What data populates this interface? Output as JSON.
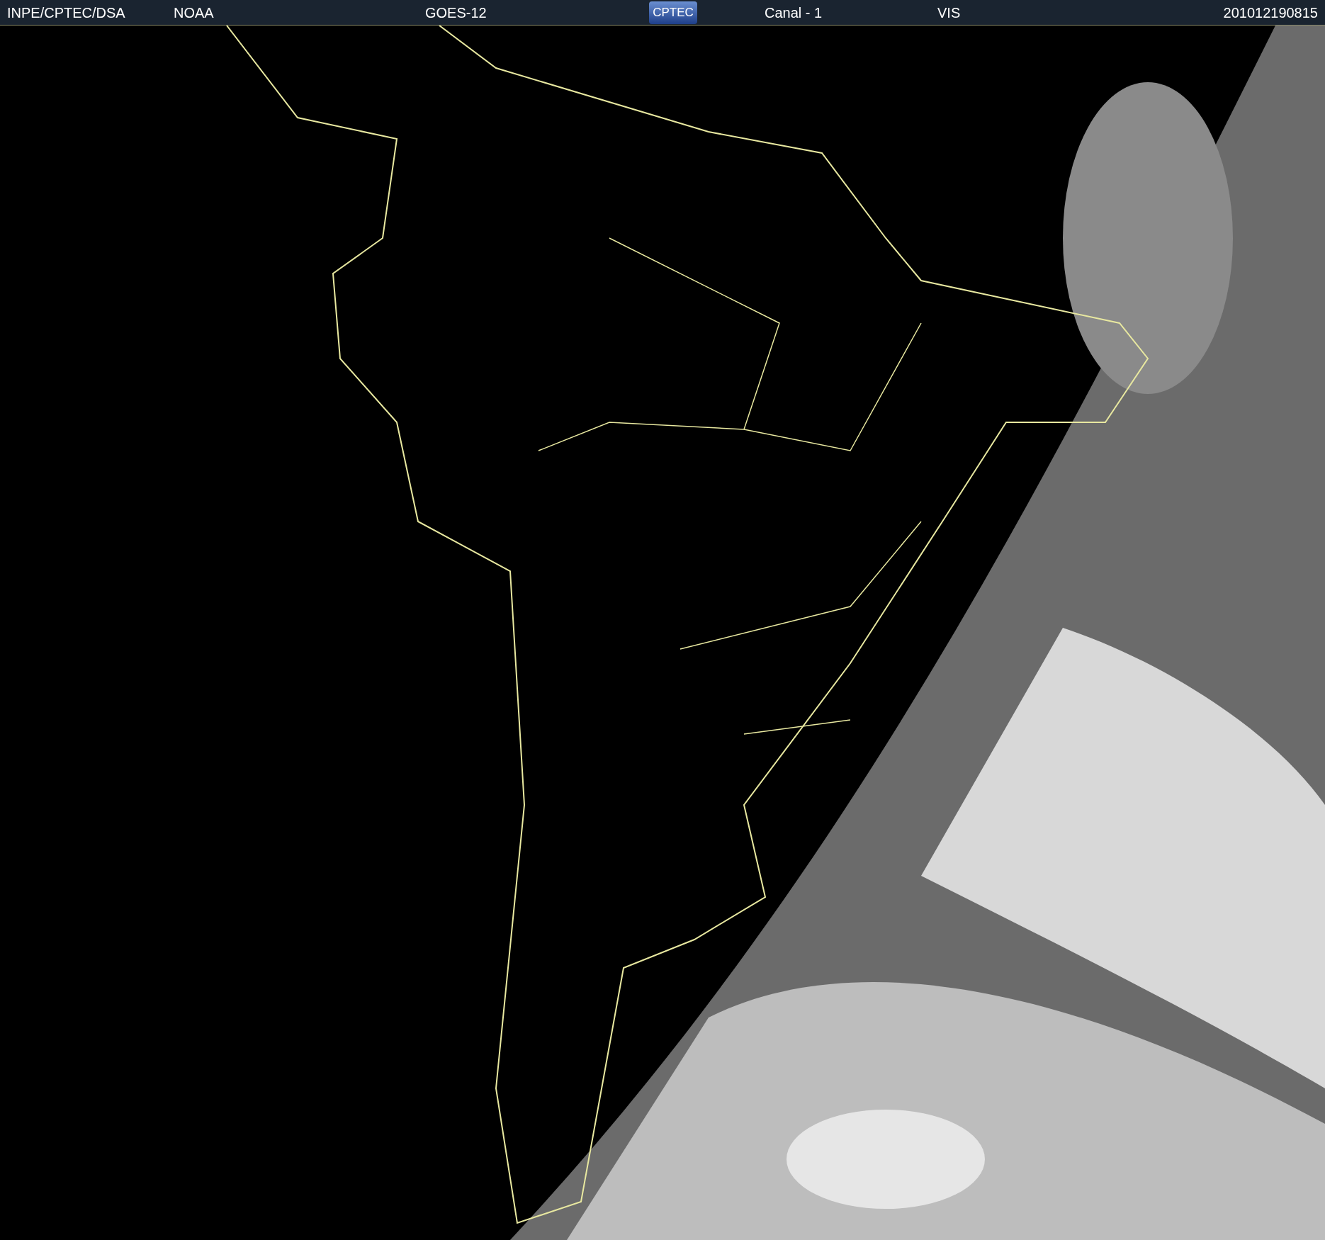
{
  "header": {
    "source": "INPE/CPTEC/DSA",
    "agency": "NOAA",
    "satellite": "GOES-12",
    "logo": "CPTEC",
    "channel": "Canal - 1",
    "band": "VIS",
    "timestamp": "201012190815"
  }
}
